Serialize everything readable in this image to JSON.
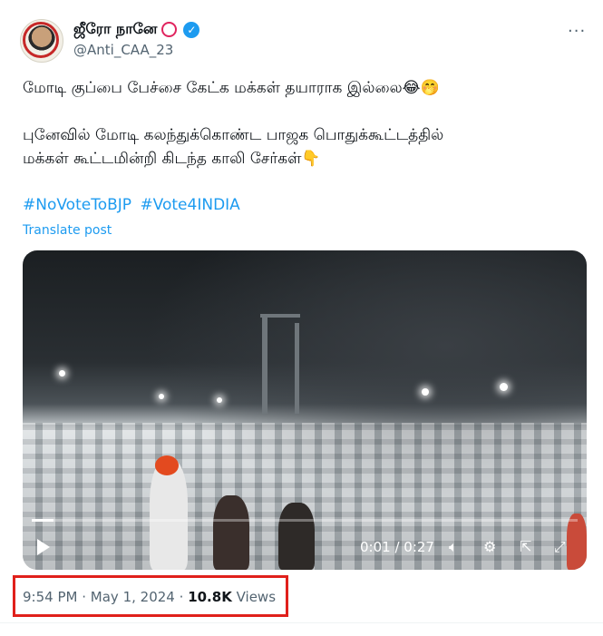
{
  "author": {
    "display_name": "ஜீரோ நானே",
    "handle": "@Anti_CAA_23",
    "verified_icon": "verified-badge-icon",
    "accent_color": "#1d9bf0"
  },
  "tweet": {
    "line1": "மோடி குப்பை பேச்சை கேட்க மக்கள் தயாராக இல்லை😂🤭",
    "line2": "புனேவில் மோடி கலந்துக்கொண்ட பாஜக பொதுக்கூட்டத்தில்",
    "line3": "மக்கள் கூட்டமின்றி கிடந்த காலி சேர்கள்👇",
    "hashtags": [
      "#NoVoteToBJP",
      "#Vote4INDIA"
    ],
    "translate_label": "Translate post"
  },
  "video": {
    "current_time": "0:01",
    "duration": "0:27",
    "time_display": "0:01 / 0:27",
    "progress_percent": 4
  },
  "meta": {
    "time": "9:54 PM",
    "separator": "·",
    "date": "May 1, 2024",
    "views_count": "10.8K",
    "views_label": "Views"
  },
  "highlight_color": "#e0201b"
}
